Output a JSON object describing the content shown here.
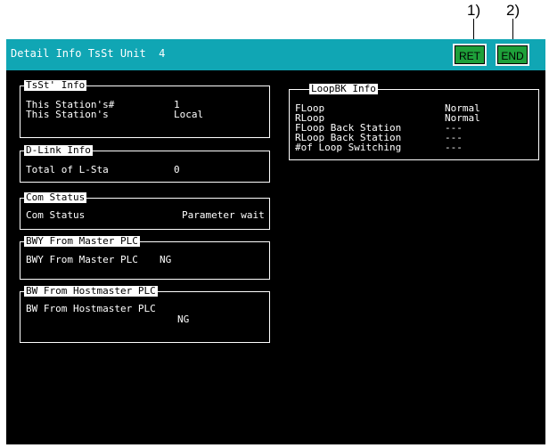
{
  "callouts": {
    "ret": "1)",
    "end": "2)"
  },
  "header": {
    "title": "Detail Info TsSt Unit  4",
    "ret_label": "RET",
    "end_label": "END"
  },
  "tsst_info": {
    "title": "TsSt' Info",
    "rows": [
      {
        "label": "This Station's#",
        "value": "1"
      },
      {
        "label": "This Station's",
        "value": "Local"
      }
    ]
  },
  "dlink_info": {
    "title": "D-Link Info",
    "rows": [
      {
        "label": "Total of L-Sta",
        "value": "0"
      }
    ]
  },
  "com_status": {
    "title": "Com Status",
    "rows": [
      {
        "label": "Com Status",
        "value": "Parameter wait"
      }
    ]
  },
  "bwy_master": {
    "title": "BWY From Master PLC",
    "rows": [
      {
        "label": "BWY From Master PLC",
        "value": "NG"
      }
    ]
  },
  "bw_hostmaster": {
    "title": "BW From Hostmaster PLC",
    "rows": [
      {
        "label": "BW From Hostmaster PLC",
        "value": "NG"
      }
    ]
  },
  "loopbk_info": {
    "title": "LoopBK Info",
    "rows": [
      {
        "label": "FLoop",
        "value": "Normal"
      },
      {
        "label": "RLoop",
        "value": "Normal"
      },
      {
        "label": "FLoop Back Station",
        "value": "---"
      },
      {
        "label": "RLoop Back Station",
        "value": "---"
      },
      {
        "label": "#of Loop Switching",
        "value": "---"
      }
    ]
  }
}
